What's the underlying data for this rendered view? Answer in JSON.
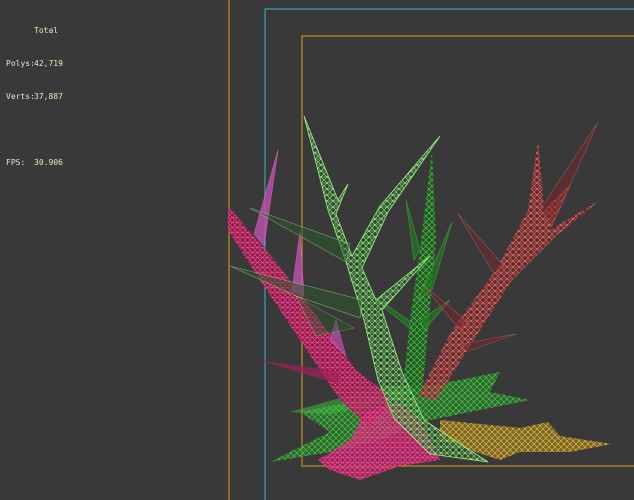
{
  "stats": {
    "header": "Total",
    "polys_label": "Polys:",
    "polys_value": "42,719",
    "verts_label": "Verts:",
    "verts_value": "37,887",
    "fps_label": "FPS:",
    "fps_value": "30.906"
  },
  "colors": {
    "viewport_bg": "#393939",
    "camera_gate": "#e0a020",
    "resolution_gate": "#3ab8c8",
    "tree_green": "#9ef08a",
    "tree_red": "#e86060",
    "tree_magenta": "#d03070",
    "tree_pink": "#e060c8",
    "tree_dark_green": "#3cb03c",
    "ground_yellow": "#d8b030"
  }
}
